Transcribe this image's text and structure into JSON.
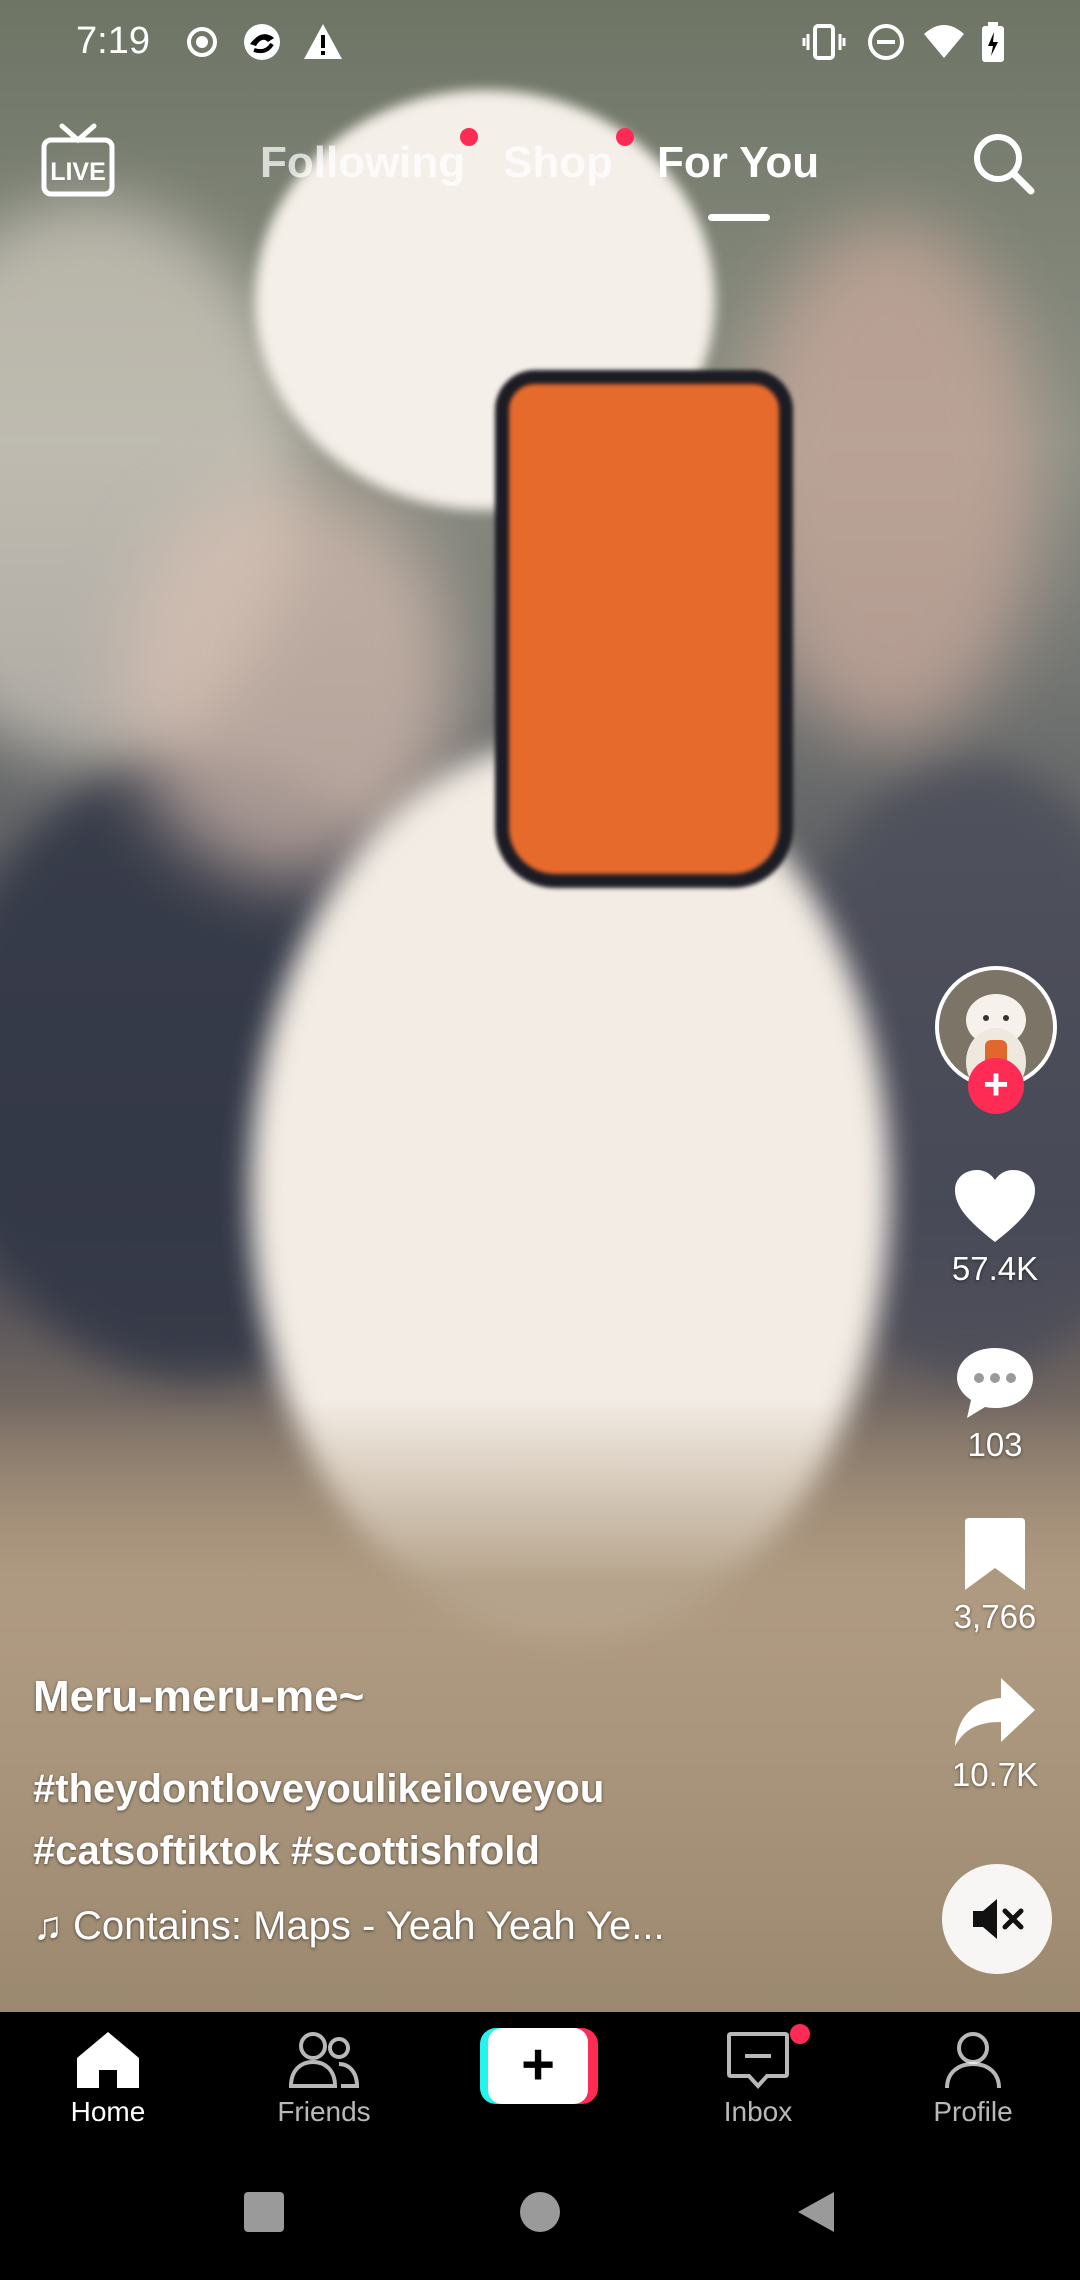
{
  "status_bar": {
    "time": "7:19",
    "icons": [
      "record-icon",
      "browser-icon",
      "warning-icon",
      "vibrate-icon",
      "dnd-icon",
      "wifi-icon",
      "battery-icon"
    ]
  },
  "top_nav": {
    "live_label": "LIVE",
    "tabs": [
      {
        "label": "Following",
        "has_dot": true
      },
      {
        "label": "Shop",
        "has_dot": true
      },
      {
        "label": "For You",
        "active": true
      }
    ]
  },
  "rail": {
    "likes": "57.4K",
    "comments": "103",
    "saves": "3,766",
    "shares": "10.7K"
  },
  "caption": {
    "username": "Meru-meru-me~",
    "hashtags_line1": "#theydontloveyoulikeiloveyou",
    "hashtags_line2": "#catsoftiktok #scottishfold",
    "music": "Contains: Maps - Yeah Yeah Ye..."
  },
  "bottom_nav": {
    "home": "Home",
    "friends": "Friends",
    "inbox": "Inbox",
    "profile": "Profile"
  },
  "colors": {
    "accent": "#fe2c55",
    "cyan": "#25f4ee"
  }
}
